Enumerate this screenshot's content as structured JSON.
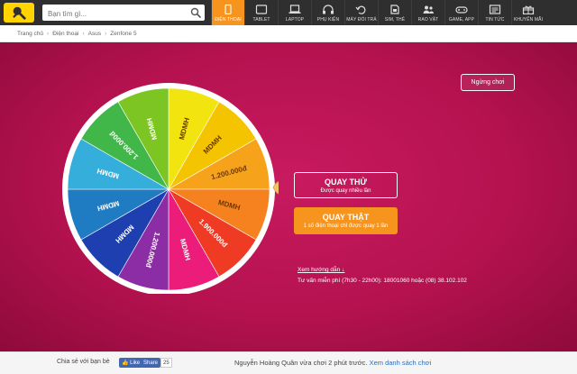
{
  "header": {
    "search_placeholder": "Bạn tìm gì...",
    "nav": [
      {
        "label": "ĐIỆN THOẠI",
        "icon": "phone-icon",
        "active": true
      },
      {
        "label": "TABLET",
        "icon": "tablet-icon"
      },
      {
        "label": "LAPTOP",
        "icon": "laptop-icon"
      },
      {
        "label": "PHỤ KIỆN",
        "icon": "headphones-icon"
      },
      {
        "label": "MÁY ĐỔI TRẢ",
        "icon": "exchange-icon"
      },
      {
        "label": "SIM, THẺ",
        "icon": "sim-icon"
      },
      {
        "label": "RAO VẶT",
        "icon": "people-icon"
      },
      {
        "label": "GAME, APP",
        "icon": "gamepad-icon"
      },
      {
        "label": "TIN TỨC",
        "icon": "news-icon"
      },
      {
        "label": "KHUYẾN MÃI",
        "icon": "gift-icon"
      }
    ]
  },
  "breadcrumb": [
    "Trang chủ",
    "Điện thoại",
    "Asus",
    "Zenfone 5"
  ],
  "stop_button": "Ngừng chơi",
  "wheel": {
    "segments": [
      {
        "label": "MDMH",
        "color": "#f2e50f"
      },
      {
        "label": "MDMH",
        "color": "#f5c400"
      },
      {
        "label": "1.200.000đ",
        "color": "#f7a21b"
      },
      {
        "label": "MDMH",
        "color": "#f5821f"
      },
      {
        "label": "1.900.000đ",
        "color": "#ef3a24"
      },
      {
        "label": "MDMH",
        "color": "#ec1c7a"
      },
      {
        "label": "1.200.000đ",
        "color": "#8d2da6"
      },
      {
        "label": "MDMH",
        "color": "#1e3fb0"
      },
      {
        "label": "MDMH",
        "color": "#1f7bc2"
      },
      {
        "label": "MDMH",
        "color": "#36aedb"
      },
      {
        "label": "1.200.000đ",
        "color": "#41b649"
      },
      {
        "label": "MDMH",
        "color": "#7dc523"
      }
    ]
  },
  "actions": {
    "try_title": "QUAY THỬ",
    "try_sub": "Được quay nhiều lần",
    "real_title": "QUAY THẬT",
    "real_sub": "1 số điện thoại chỉ được quay 1 lần"
  },
  "guide_link": "Xem hướng dẫn ↓",
  "hotline": "Tư vấn miễn phí (7h30 - 22h00): 18001060 hoặc (08) 38.102.102",
  "footer": {
    "share_text": "Chia sẻ với bạn bè",
    "like_label": "Like",
    "share_label": "Share",
    "share_count": "25",
    "activity_text": "Nguyễn Hoàng Quân vừa chơi 2 phút trước.",
    "activity_link": "Xem danh sách chơi"
  }
}
